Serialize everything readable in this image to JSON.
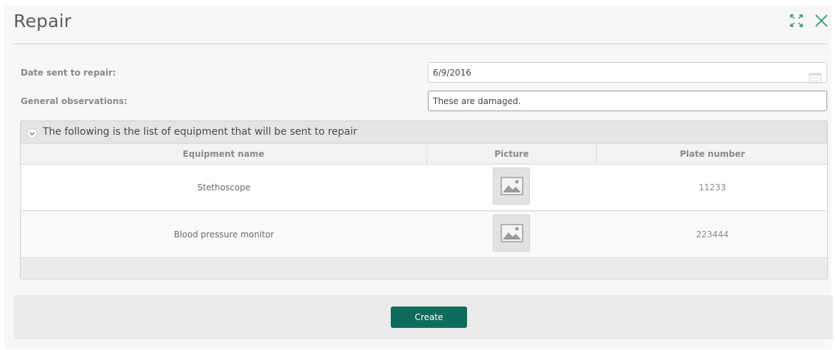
{
  "dialog": {
    "title": "Repair",
    "maximize_icon": "maximize-icon",
    "close_icon": "close-icon"
  },
  "form": {
    "date_label": "Date sent to repair:",
    "date_value": "6/9/2016",
    "calendar_icon": "calendar-icon",
    "observations_label": "General observations:",
    "observations_value": "These are damaged."
  },
  "grid": {
    "caption": "The following is the list of equipment that will be sent to repair",
    "collapse_icon": "chevron-down-icon",
    "columns": [
      "Equipment name",
      "Picture",
      "Plate number"
    ],
    "rows": [
      {
        "equipment_name": "Stethoscope",
        "picture_icon": "image-placeholder-icon",
        "plate_number": "11233"
      },
      {
        "equipment_name": "Blood pressure monitor",
        "picture_icon": "image-placeholder-icon",
        "plate_number": "223444"
      }
    ]
  },
  "footer": {
    "create_label": "Create"
  },
  "colors": {
    "accent": "#0f6b5c",
    "background": "#f7f7f7",
    "footer": "#e9ebea"
  }
}
